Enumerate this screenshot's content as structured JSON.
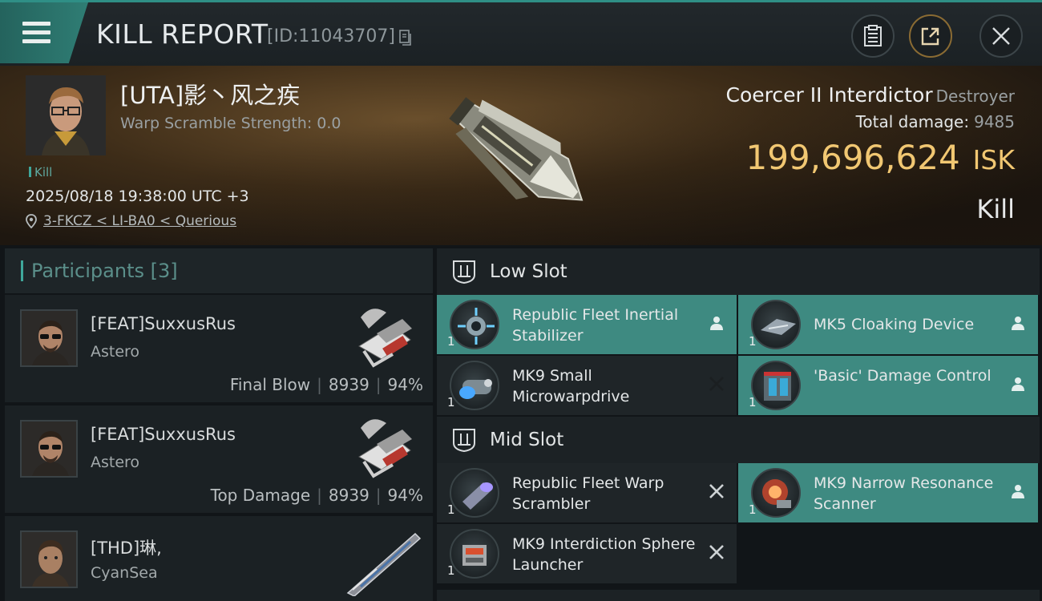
{
  "header": {
    "title": "KILL REPORT",
    "id_label": "[ID:11043707]"
  },
  "victim": {
    "name": "[UTA]影丶风之疾",
    "scram_strength": "Warp Scramble Strength: 0.0",
    "tag": "Kill",
    "datetime": "2025/08/18 19:38:00 UTC +3",
    "location": "3-FKCZ < LI-BA0 < Querious"
  },
  "ship": {
    "name": "Coercer II Interdictor",
    "class": "Destroyer",
    "total_damage_label": "Total damage:",
    "total_damage_value": "9485",
    "isk_value": "199,696,624",
    "isk_unit": "ISK",
    "result": "Kill"
  },
  "participants": {
    "title": "Participants [3]",
    "items": [
      {
        "name": "[FEAT]SuxxusRus",
        "ship": "Astero",
        "role": "Final Blow",
        "damage": "8939",
        "percent": "94%"
      },
      {
        "name": "[FEAT]SuxxusRus",
        "ship": "Astero",
        "role": "Top Damage",
        "damage": "8939",
        "percent": "94%"
      },
      {
        "name": "[THD]琳,",
        "ship": "CyanSea",
        "role": "",
        "damage": "",
        "percent": ""
      }
    ]
  },
  "fittings": {
    "low_slot_title": "Low Slot",
    "mid_slot_title": "Mid Slot",
    "low": [
      {
        "name": "Republic Fleet Inertial Stabilizer",
        "qty": "1",
        "state": "dropped",
        "icon": "stabilizer-icon"
      },
      {
        "name": "MK5 Cloaking Device",
        "qty": "1",
        "state": "dropped",
        "icon": "cloak-icon"
      },
      {
        "name": "MK9 Small Microwarpdrive",
        "qty": "1",
        "state": "destroyed",
        "icon": "mwd-icon"
      },
      {
        "name": "'Basic' Damage Control",
        "qty": "1",
        "state": "dropped",
        "icon": "damage-control-icon"
      }
    ],
    "mid": [
      {
        "name": "Republic Fleet Warp Scrambler",
        "qty": "1",
        "state": "destroyed",
        "icon": "scrambler-icon"
      },
      {
        "name": "MK9 Narrow Resonance Scanner",
        "qty": "1",
        "state": "dropped",
        "icon": "scanner-icon"
      },
      {
        "name": "MK9 Interdiction Sphere Launcher",
        "qty": "1",
        "state": "destroyed",
        "icon": "launcher-icon"
      }
    ]
  },
  "colors": {
    "accent_teal": "#3e8a81",
    "isk_gold": "#f1c772",
    "background": "#111518"
  }
}
